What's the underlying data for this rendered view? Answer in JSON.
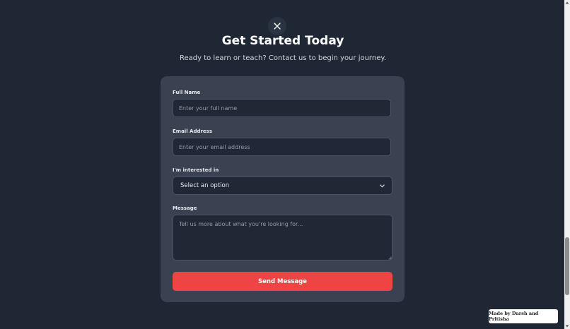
{
  "header": {
    "close_icon": "close-icon",
    "title": "Get Started Today",
    "subtitle": "Ready to learn or teach? Contact us to begin your journey."
  },
  "form": {
    "full_name": {
      "label": "Full Name",
      "placeholder": "Enter your full name",
      "value": ""
    },
    "email": {
      "label": "Email Address",
      "placeholder": "Enter your email address",
      "value": ""
    },
    "interest": {
      "label": "I'm interested in",
      "selected": "Select an option",
      "icon": "chevron-down-icon"
    },
    "message": {
      "label": "Message",
      "placeholder": "Tell us more about what you're looking for...",
      "value": ""
    },
    "submit_label": "Send Message"
  },
  "footer": {
    "credit": "Made by Darsh and Pritisha"
  },
  "colors": {
    "background": "#1f2735",
    "card": "#3a4252",
    "input": "#202836",
    "accent": "#ef4444"
  }
}
